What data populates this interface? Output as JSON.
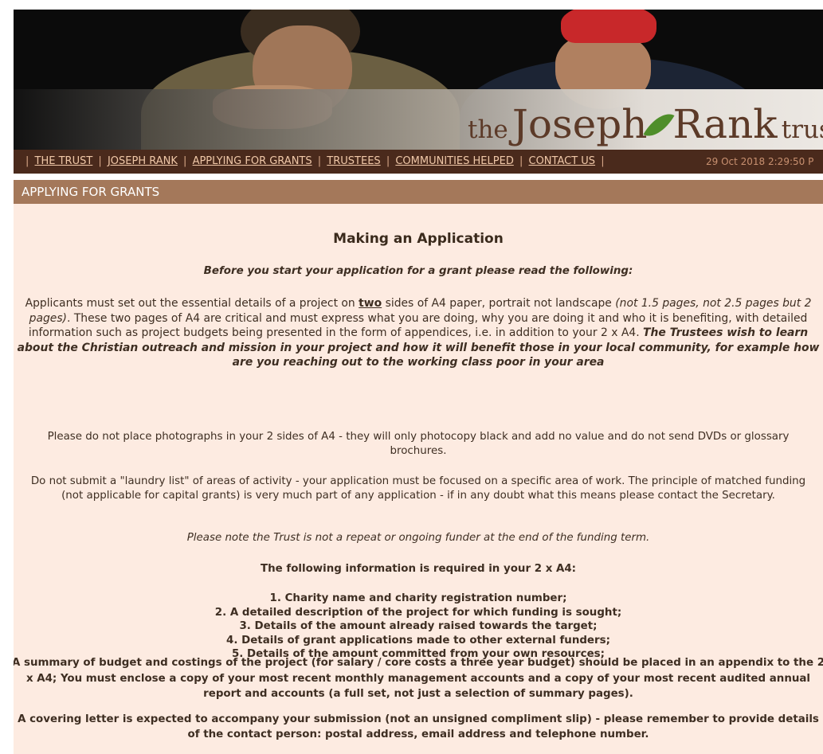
{
  "banner": {
    "logo_pre": "the",
    "logo_name": "Joseph",
    "logo_surname": "Rank",
    "logo_post": "trust"
  },
  "nav": {
    "items": [
      "THE TRUST",
      "JOSEPH RANK",
      "APPLYING FOR GRANTS",
      "TRUSTEES",
      "COMMUNITIES HELPED",
      "CONTACT US"
    ],
    "datetime": "29 Oct 2018 2:29:50 P"
  },
  "section_title": "APPLYING FOR GRANTS",
  "content": {
    "heading": "Making an Application",
    "intro": "Before you start your application for a grant please read the following:",
    "p1": {
      "a": "Applicants must set out the essential details of a project on ",
      "two": "two",
      "b": " sides of A4 paper, portrait not landscape ",
      "italic1": "(not 1.5 pages, not 2.5 pages but 2 pages)",
      "c": ". These two pages of A4 are critical and must express what you are doing, why you are doing it and who it is benefiting, with detailed information such as project budgets being presented in the form of appendices, i.e. in addition to your 2 x A4. ",
      "bold_italic": "The Trustees wish to learn about the Christian outreach and mission in your project and how it will benefit those in your local community, for example how are you reaching out to the working class poor in your area"
    },
    "p2": "Please do not place photographs in your 2 sides of A4 - they will only photocopy black and add no value and do not send DVDs or glossary brochures.",
    "p3": "Do not submit a \"laundry list\" of areas of activity - your application must be focused on a specific area of work. The principle of matched funding (not applicable for capital grants) is very much part of any application - if in any doubt what this means please contact the Secretary.",
    "p4": "Please note the Trust is not a repeat or ongoing funder at the end of the funding term.",
    "req_heading": "The following information is required in your 2 x A4:",
    "requirements": [
      "1. Charity name and charity registration number;",
      "2. A detailed description of the project for which funding is sought;",
      "3. Details of the amount already raised towards the target;",
      "4. Details of grant applications made to other external funders;",
      "5. Details of the amount committed from your own resources;"
    ],
    "p5": "A summary of budget and costings of the project (for salary / core costs a three year budget) should be placed in an appendix to the 2 x A4; You must enclose a copy of your most recent monthly management accounts and a copy of your most recent audited annual report and accounts (a full set, not just a selection of summary pages).",
    "p6": "A covering letter is expected to accompany your submission (not an unsigned compliment slip) - please remember to provide details of the contact person: postal address, email address and telephone number."
  }
}
